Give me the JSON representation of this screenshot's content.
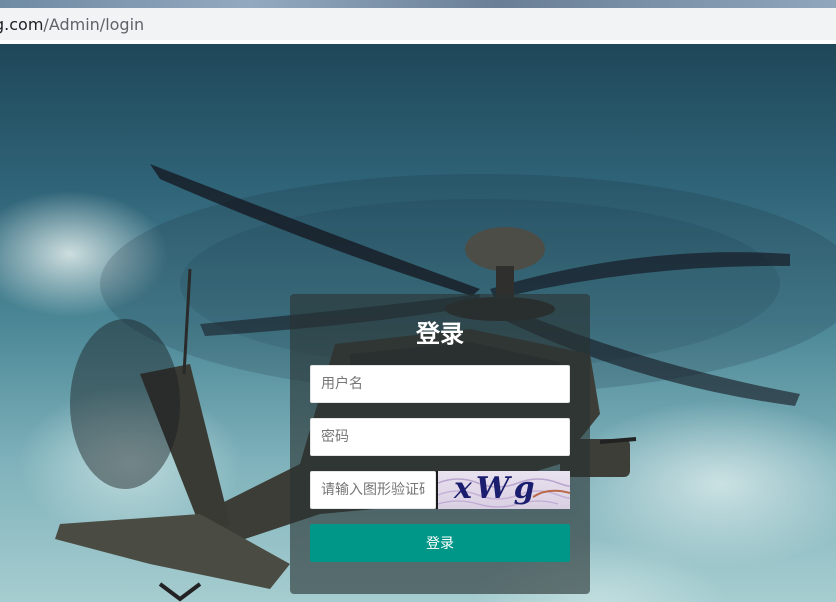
{
  "browser": {
    "url_host": "g.com",
    "url_path": "/Admin/login"
  },
  "login": {
    "title": "登录",
    "username_placeholder": "用户名",
    "password_placeholder": "密码",
    "captcha_placeholder": "请输入图形验证码",
    "captcha_text": "xWg",
    "submit_label": "登录"
  },
  "colors": {
    "accent": "#009688",
    "card_background": "rgba(40,50,50,0.62)"
  },
  "icons": {
    "background": "helicopter-background-image",
    "captcha": "captcha-image"
  }
}
